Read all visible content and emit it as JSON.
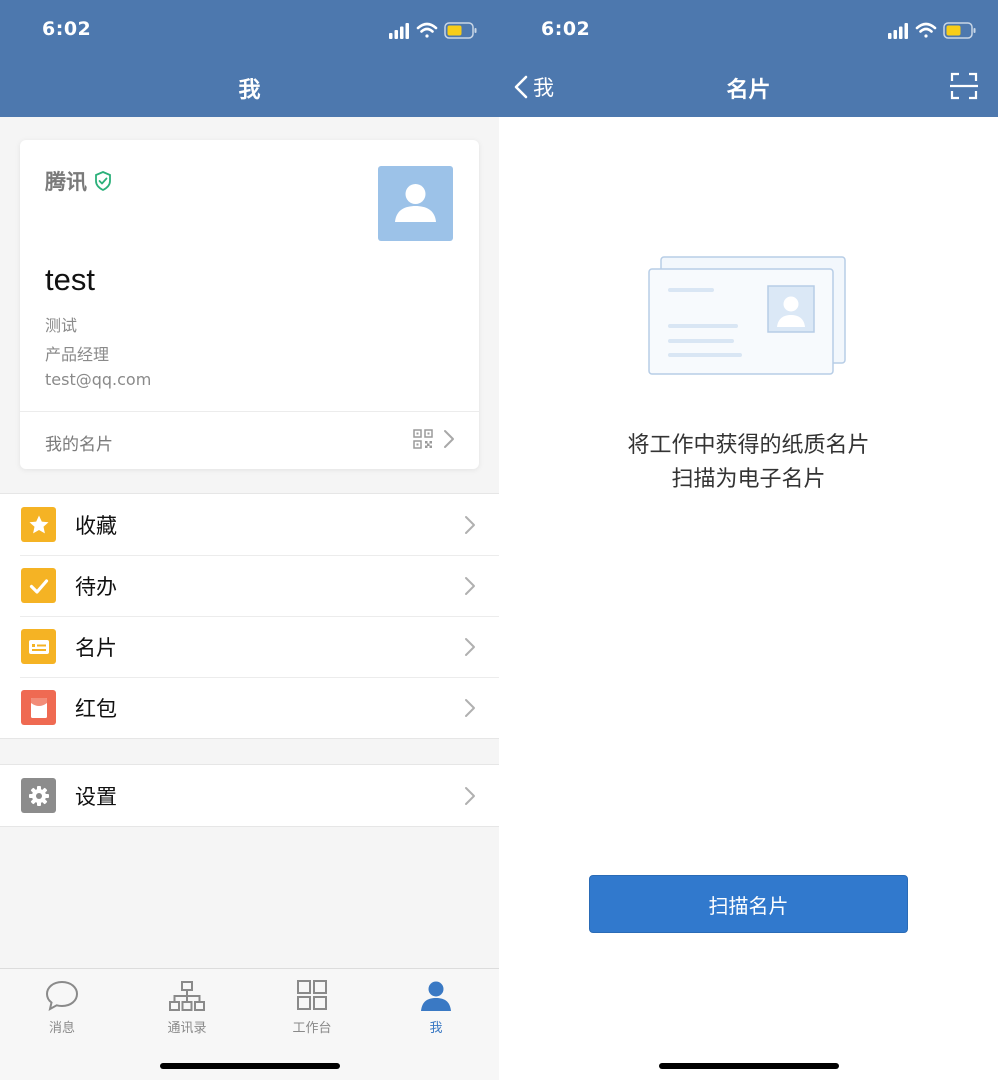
{
  "status_bar": {
    "time": "6:02"
  },
  "left": {
    "nav_title": "我",
    "profile": {
      "company": "腾讯",
      "name": "test",
      "department": "测试",
      "position": "产品经理",
      "email": "test@qq.com",
      "my_card_label": "我的名片"
    },
    "menu": {
      "favorites": "收藏",
      "todo": "待办",
      "business_card": "名片",
      "red_packet": "红包",
      "settings": "设置"
    },
    "tabs": {
      "messages": "消息",
      "contacts": "通讯录",
      "workbench": "工作台",
      "me": "我"
    }
  },
  "right": {
    "back_label": "我",
    "nav_title": "名片",
    "description_line1": "将工作中获得的纸质名片",
    "description_line2": "扫描为电子名片",
    "scan_button": "扫描名片"
  },
  "colors": {
    "nav_bar": "#4d78ae",
    "accent_blue": "#3179cd",
    "favorites_icon": "#f5b324",
    "red_packet_icon": "#ef6a52",
    "settings_icon": "#8c8c8c",
    "verified_green": "#2bb07a"
  },
  "icons": [
    "signal-icon",
    "wifi-icon",
    "battery-icon",
    "verified-shield-icon",
    "avatar-placeholder-icon",
    "qr-code-icon",
    "chevron-right-icon",
    "star-icon",
    "check-icon",
    "card-icon",
    "red-packet-icon",
    "gear-icon",
    "chat-icon",
    "org-chart-icon",
    "grid-icon",
    "person-icon",
    "back-chevron-icon",
    "scan-frame-icon",
    "business-card-illustration"
  ]
}
